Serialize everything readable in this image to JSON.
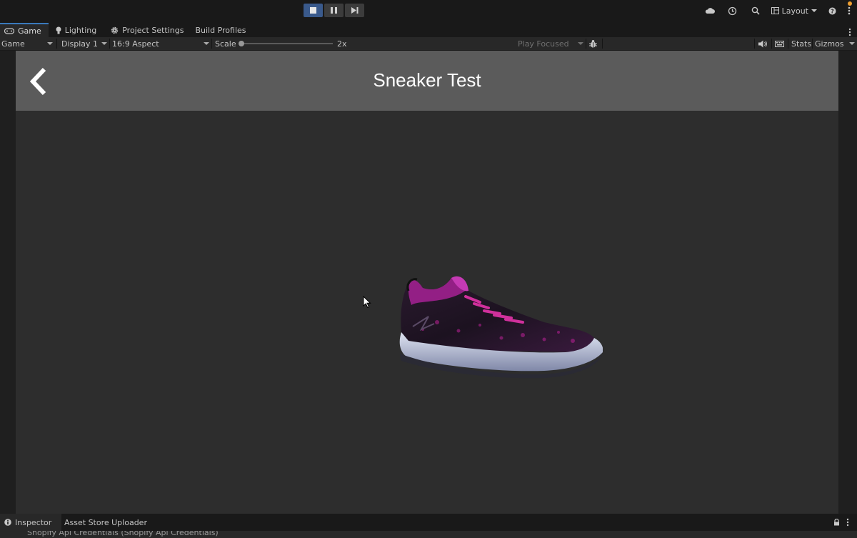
{
  "toolbar": {
    "layout_label": "Layout"
  },
  "tabs": [
    {
      "label": "Game",
      "icon": "gamepad-icon",
      "active": true
    },
    {
      "label": "Lighting",
      "icon": "bulb-icon",
      "active": false
    },
    {
      "label": "Project Settings",
      "icon": "gear-icon",
      "active": false
    },
    {
      "label": "Build Profiles",
      "icon": "",
      "active": false
    }
  ],
  "game_toolbar": {
    "view_select": "Game",
    "display_select": "Display 1",
    "aspect_select": "16:9 Aspect",
    "scale_label": "Scale",
    "scale_value": "2x",
    "scale_slider_fraction": 0.0,
    "play_mode_select": "Play Focused",
    "stats_label": "Stats",
    "gizmos_label": "Gizmos"
  },
  "game_view": {
    "header_title": "Sneaker Test",
    "header_bg": "#5b5b5b",
    "background": "#2d2d2d"
  },
  "bottom": {
    "tabs": [
      {
        "label": "Inspector",
        "icon": "info-icon",
        "active": true
      },
      {
        "label": "Asset Store Uploader",
        "icon": "",
        "active": false
      }
    ],
    "subtitle": "Shopify Api Credentials (Shopify Api Credentials)"
  },
  "colors": {
    "accent": "#3a79bb",
    "play_active": "#3a5a8c",
    "notification": "#f0a030"
  }
}
